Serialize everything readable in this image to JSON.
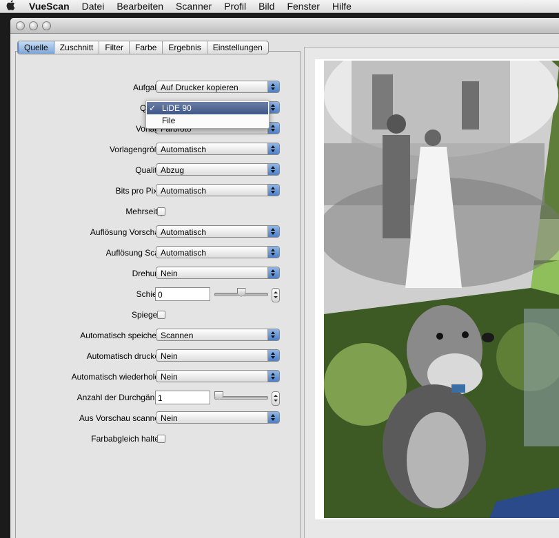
{
  "menubar": {
    "apple_icon": "apple-logo",
    "app_name": "VueScan",
    "items": [
      "Datei",
      "Bearbeiten",
      "Scanner",
      "Profil",
      "Bild",
      "Fenster",
      "Hilfe"
    ]
  },
  "tabs": [
    "Quelle",
    "Zuschnitt",
    "Filter",
    "Farbe",
    "Ergebnis",
    "Einstellungen"
  ],
  "active_tab": "Quelle",
  "form": {
    "aufgabe": {
      "label": "Aufgabe:",
      "value": "Auf Drucker kopieren"
    },
    "quelle": {
      "label": "Quelle:"
    },
    "vorlage": {
      "label": "Vorlage:",
      "value": "Farbfoto"
    },
    "vorlagengroesse": {
      "label": "Vorlagengröße:",
      "value": "Automatisch"
    },
    "qualitaet": {
      "label": "Qualität:",
      "value": "Abzug"
    },
    "bits": {
      "label": "Bits pro Pixel:",
      "value": "Automatisch"
    },
    "mehrseitig": {
      "label": "Mehrseitig:"
    },
    "aufl_vorschau": {
      "label": "Auflösung Vorschau:",
      "value": "Automatisch"
    },
    "aufl_scan": {
      "label": "Auflösung Scan:",
      "value": "Automatisch"
    },
    "drehung": {
      "label": "Drehung:",
      "value": "Nein"
    },
    "schiefe": {
      "label": "Schiefe:",
      "value": "0"
    },
    "spiegeln": {
      "label": "Spiegeln:"
    },
    "auto_speichern": {
      "label": "Automatisch speichern:",
      "value": "Scannen"
    },
    "auto_drucken": {
      "label": "Automatisch drucken:",
      "value": "Nein"
    },
    "auto_wiederholen": {
      "label": "Automatisch wiederholen:",
      "value": "Nein"
    },
    "durchgaenge": {
      "label": "Anzahl der Durchgänge:",
      "value": "1"
    },
    "aus_vorschau": {
      "label": "Aus Vorschau scannen:",
      "value": "Nein"
    },
    "farbabgleich": {
      "label": "Farbabgleich halten:"
    }
  },
  "sliders": {
    "schiefe_level": 0.5,
    "durchgaenge_level": 0.0
  },
  "source_dropdown": {
    "check_mark": "✓",
    "options": [
      "LiDE 90",
      "File"
    ],
    "selected": "LiDE 90"
  },
  "colors": {
    "selection": "#3f5688",
    "select_arrows": "#4e80c8"
  }
}
